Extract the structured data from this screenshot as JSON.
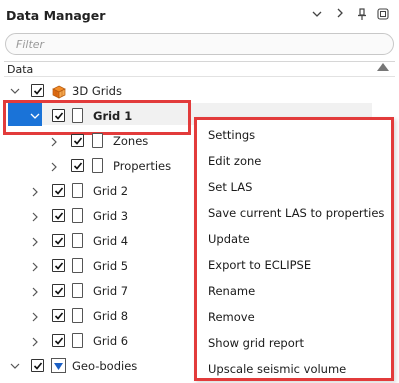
{
  "panel": {
    "title": "Data Manager",
    "title_icons": [
      "chevron-down-icon",
      "chevron-right-icon",
      "pin-icon",
      "detach-icon"
    ]
  },
  "filter": {
    "placeholder": "Filter",
    "value": ""
  },
  "column_header": {
    "label": "Data",
    "sort": "ascending"
  },
  "tree": {
    "root": {
      "label": "3D Grids",
      "checked": true,
      "expanded": true,
      "icon": "3d-grids-icon"
    },
    "grids": [
      {
        "label": "Grid 1",
        "checked": true,
        "expanded": true,
        "selected": true,
        "children": [
          {
            "label": "Zones",
            "checked": true
          },
          {
            "label": "Properties",
            "checked": true
          }
        ]
      },
      {
        "label": "Grid 2",
        "checked": true
      },
      {
        "label": "Grid 3",
        "checked": true
      },
      {
        "label": "Grid 4",
        "checked": true
      },
      {
        "label": "Grid 5",
        "checked": true
      },
      {
        "label": "Grid 7",
        "checked": true
      },
      {
        "label": "Grid 8",
        "checked": true
      },
      {
        "label": "Grid 6",
        "checked": true
      }
    ],
    "geobodies": {
      "label": "Geo-bodies",
      "checked": true,
      "expanded": true,
      "icon": "geo-bodies-icon"
    }
  },
  "context_menu": {
    "items": [
      "Settings",
      "Edit zone",
      "Set LAS",
      "Save current LAS to properties",
      "Update",
      "Export to ECLIPSE",
      "Rename",
      "Remove",
      "Show grid report",
      "Upscale seismic volume"
    ]
  },
  "colors": {
    "selection": "#1a73d8",
    "highlight_border": "#e23b3b"
  }
}
